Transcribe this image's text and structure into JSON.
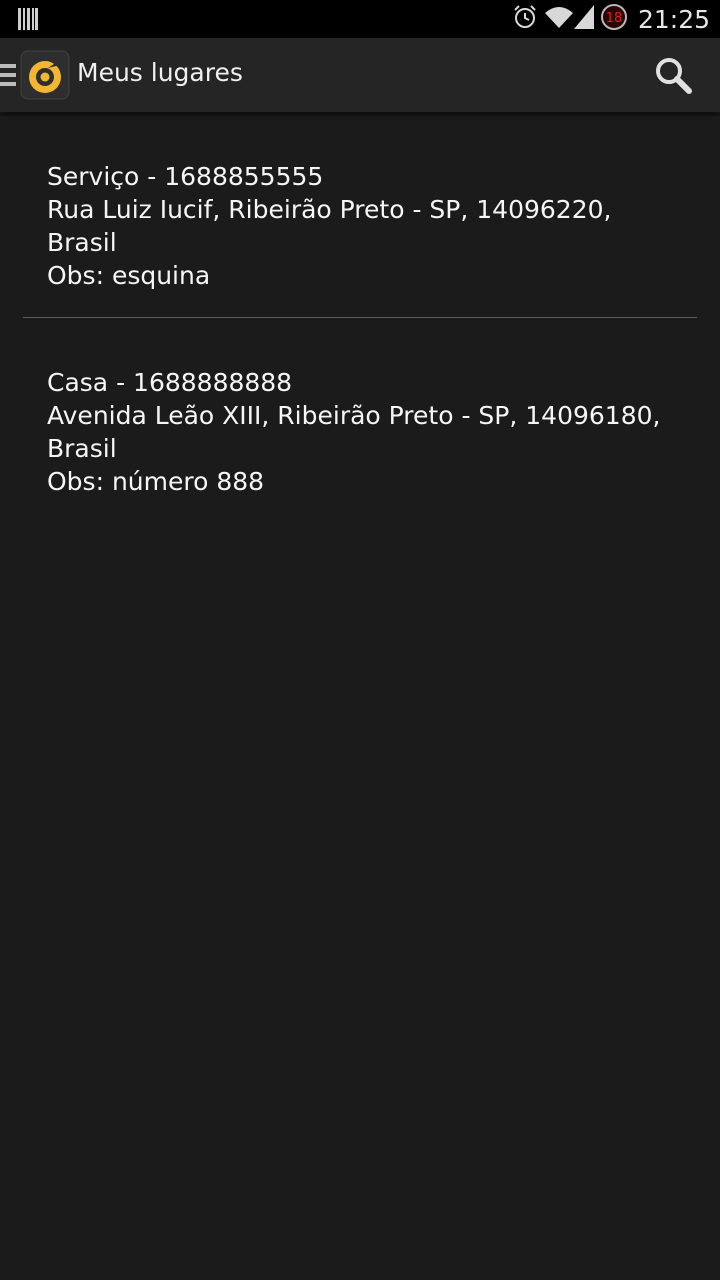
{
  "status_bar": {
    "time": "21:25",
    "notification_count": "18"
  },
  "action_bar": {
    "title": "Meus lugares"
  },
  "places": [
    {
      "title": "Serviço  - 1688855555",
      "address_line1": "Rua Luiz Iucif, Ribeirão Preto - SP, 14096220,",
      "address_line2": "Brasil",
      "obs": "Obs: esquina"
    },
    {
      "title": "Casa - 1688888888",
      "address_line1": "Avenida Leão XIII, Ribeirão Preto - SP, 14096180,",
      "address_line2": "Brasil",
      "obs": "Obs: número 888"
    }
  ],
  "colors": {
    "background": "#1b1b1b",
    "action_bar": "#252525",
    "logo_accent": "#f3b632",
    "divider": "#5c5c5c"
  }
}
